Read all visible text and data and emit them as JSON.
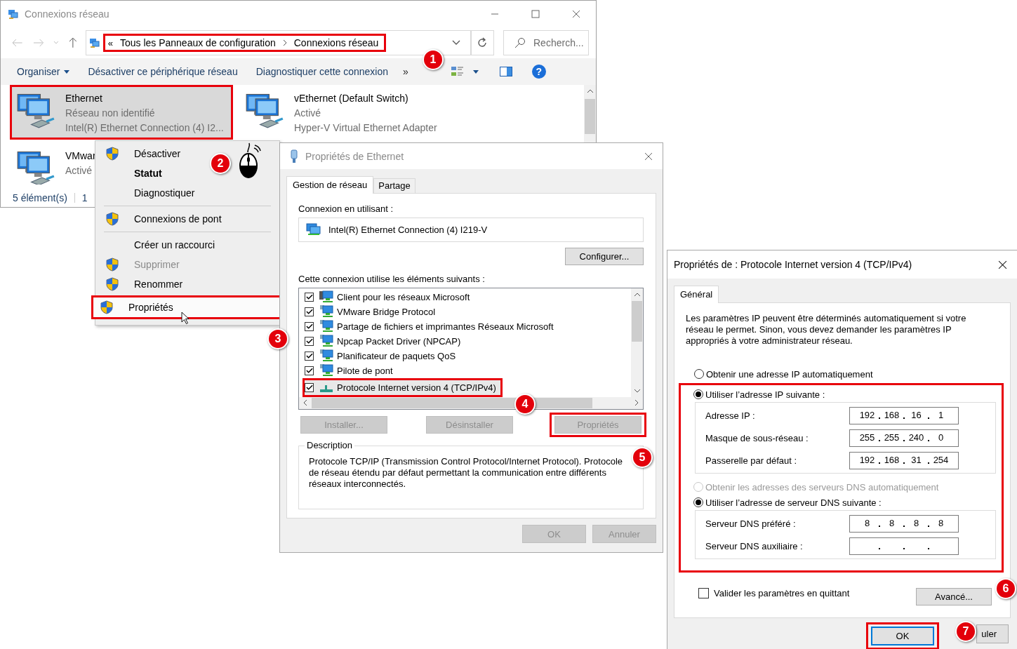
{
  "explorer": {
    "title": "Connexions réseau",
    "address": {
      "prefix": "«",
      "crumbs": [
        "Tous les Panneaux de configuration",
        "Connexions réseau"
      ],
      "highlighted": true
    },
    "search": {
      "placeholder": "Recherch..."
    },
    "commands": [
      {
        "label": "Organiser",
        "dropdown": true
      },
      {
        "label": "Désactiver ce périphérique réseau",
        "dropdown": false
      },
      {
        "label": "Diagnostiquer cette connexion",
        "dropdown": false
      }
    ],
    "more": "»",
    "help": "?",
    "adapters": [
      {
        "name": "Ethernet",
        "status": "Réseau non identifié",
        "device": "Intel(R) Ethernet Connection (4) I2...",
        "selected": true,
        "highlighted": true
      },
      {
        "name": "vEthernet (Default Switch)",
        "status": "Activé",
        "device": "Hyper-V Virtual Ethernet Adapter",
        "selected": false,
        "highlighted": false
      },
      {
        "name": "VMwar",
        "status": "Activé",
        "selected": false,
        "highlighted": false
      }
    ],
    "status_bar": [
      "5 élément(s)",
      "1"
    ]
  },
  "context_menu": {
    "groups": [
      [
        {
          "label": "Désactiver",
          "shield": true,
          "bold": false,
          "disabled": false,
          "highlighted": false
        },
        {
          "label": "Statut",
          "shield": false,
          "bold": true,
          "disabled": false,
          "highlighted": false
        },
        {
          "label": "Diagnostiquer",
          "shield": false,
          "bold": false,
          "disabled": false,
          "highlighted": false
        }
      ],
      [
        {
          "label": "Connexions de pont",
          "shield": true,
          "bold": false,
          "disabled": false,
          "highlighted": false
        }
      ],
      [
        {
          "label": "Créer un raccourci",
          "shield": false,
          "bold": false,
          "disabled": false,
          "highlighted": false
        },
        {
          "label": "Supprimer",
          "shield": true,
          "bold": false,
          "disabled": true,
          "highlighted": false
        },
        {
          "label": "Renommer",
          "shield": true,
          "bold": false,
          "disabled": false,
          "highlighted": false
        },
        {
          "label": "Propriétés",
          "shield": true,
          "bold": false,
          "disabled": false,
          "highlighted": true
        }
      ]
    ]
  },
  "ethernet_dialog": {
    "title": "Propriétés de Ethernet",
    "tabs": [
      {
        "label": "Gestion de réseau",
        "selected": true
      },
      {
        "label": "Partage",
        "selected": false
      }
    ],
    "connect_label": "Connexion en utilisant :",
    "adapter": "Intel(R) Ethernet Connection (4) I219-V",
    "configure_button": "Configurer...",
    "components_label": "Cette connexion utilise les éléments suivants :",
    "components": [
      {
        "label": "Client pour les réseaux Microsoft",
        "kind": "client",
        "checked": true,
        "selected": false,
        "highlighted": false
      },
      {
        "label": "VMware Bridge Protocol",
        "kind": "service",
        "checked": true,
        "selected": false,
        "highlighted": false
      },
      {
        "label": "Partage de fichiers et imprimantes Réseaux Microsoft",
        "kind": "service",
        "checked": true,
        "selected": false,
        "highlighted": false
      },
      {
        "label": "Npcap Packet Driver (NPCAP)",
        "kind": "service",
        "checked": true,
        "selected": false,
        "highlighted": false
      },
      {
        "label": "Planificateur de paquets QoS",
        "kind": "service",
        "checked": true,
        "selected": false,
        "highlighted": false
      },
      {
        "label": "Pilote de pont",
        "kind": "service",
        "checked": true,
        "selected": false,
        "highlighted": false
      },
      {
        "label": "Protocole Internet version 4 (TCP/IPv4)",
        "kind": "protocol",
        "checked": true,
        "selected": true,
        "highlighted": true
      }
    ],
    "actions": [
      {
        "label": "Installer...",
        "disabled": true,
        "highlighted": false
      },
      {
        "label": "Désinstaller",
        "disabled": true,
        "highlighted": false
      },
      {
        "label": "Propriétés",
        "disabled": true,
        "highlighted": true
      }
    ],
    "description": {
      "legend": "Description",
      "text": "Protocole TCP/IP (Transmission Control Protocol/Internet Protocol). Protocole de réseau étendu par défaut permettant la communication entre différents réseaux interconnectés."
    },
    "buttons": [
      {
        "label": "OK",
        "disabled": true
      },
      {
        "label": "Annuler",
        "disabled": true
      }
    ]
  },
  "ipv4_dialog": {
    "title": "Propriétés de : Protocole Internet version 4 (TCP/IPv4)",
    "tabs": [
      {
        "label": "Général",
        "selected": true
      }
    ],
    "intro": "Les paramètres IP peuvent être déterminés automatiquement si votre réseau le permet. Sinon, vous devez demander les paramètres IP appropriés à votre administrateur réseau.",
    "manual_section_highlighted": true,
    "ip_mode": [
      {
        "label": "Obtenir une adresse IP automatiquement",
        "selected": false,
        "disabled": false
      },
      {
        "label": "Utiliser l’adresse IP suivante :",
        "selected": true,
        "disabled": false
      }
    ],
    "ip_fields": [
      {
        "label": "Adresse IP :",
        "octets": [
          "192",
          "168",
          "16",
          "1"
        ]
      },
      {
        "label": "Masque de sous-réseau :",
        "octets": [
          "255",
          "255",
          "240",
          "0"
        ]
      },
      {
        "label": "Passerelle par défaut :",
        "octets": [
          "192",
          "168",
          "31",
          "254"
        ]
      }
    ],
    "dns_mode": [
      {
        "label": "Obtenir les adresses des serveurs DNS automatiquement",
        "selected": false,
        "disabled": true
      },
      {
        "label": "Utiliser l’adresse de serveur DNS suivante :",
        "selected": true,
        "disabled": false
      }
    ],
    "dns_fields": [
      {
        "label": "Serveur DNS préféré :",
        "octets": [
          "8",
          "8",
          "8",
          "8"
        ]
      },
      {
        "label": "Serveur DNS auxiliaire :"
      }
    ],
    "validate": {
      "label": "Valider les paramètres en quittant",
      "checked": false
    },
    "advanced_button": "Avancé...",
    "buttons": [
      {
        "label": "OK",
        "default": true,
        "highlighted": true
      },
      {
        "label": "uler",
        "default": false,
        "highlighted": false
      }
    ]
  },
  "annotations": [
    {
      "number": "1"
    },
    {
      "number": "2"
    },
    {
      "number": "3"
    },
    {
      "number": "4"
    },
    {
      "number": "5"
    },
    {
      "number": "6"
    },
    {
      "number": "7"
    }
  ]
}
